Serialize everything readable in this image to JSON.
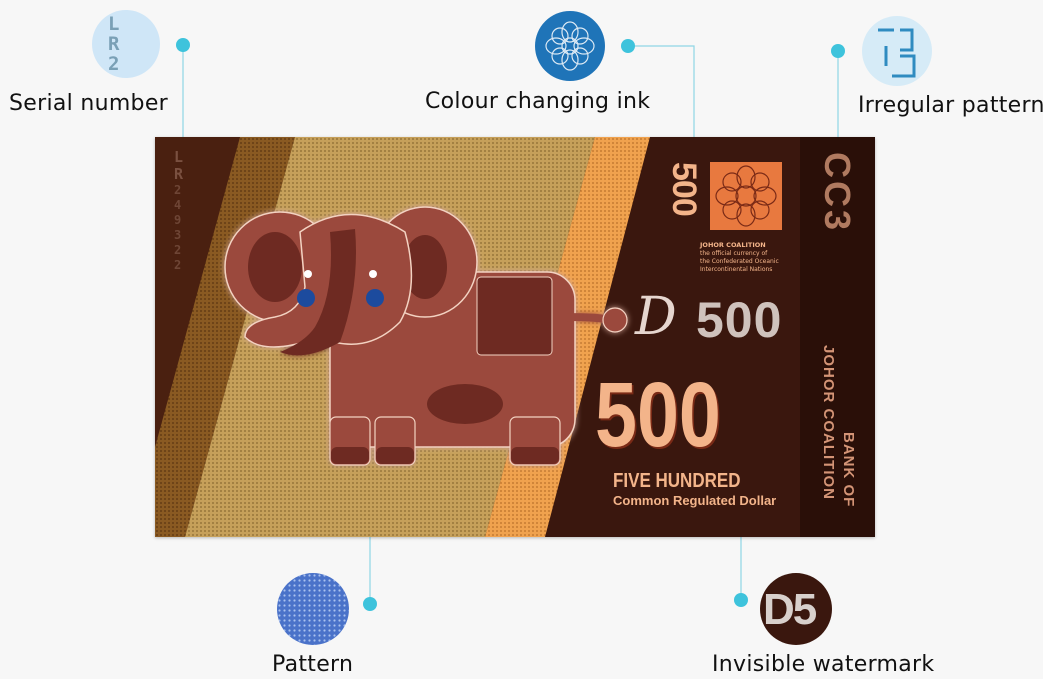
{
  "callouts": {
    "serial_number": "Serial number",
    "colour_changing_ink": "Colour changing ink",
    "irregular_pattern": "Irregular pattern",
    "pattern": "Pattern",
    "invisible_watermark": "Invisible watermark"
  },
  "banknote": {
    "serial_prefix": "LR",
    "serial_digits": "249322",
    "denomination": "500",
    "denomination_symbol": "D",
    "amount_words": "FIVE HUNDRED",
    "currency_name": "Common Regulated Dollar",
    "issuer_line1": "JOHOR COALITION",
    "issuer_line2": "the official currency of",
    "issuer_line3": "the Confederated Oceanic",
    "issuer_line4": "Intercontinental Nations",
    "bank_line1": "BANK OF",
    "bank_line2": "JOHOR COALITION",
    "watermark_text": "D5",
    "irregular_glyphs": "CC3",
    "thumb_serial": "LR2"
  },
  "colors": {
    "accent_dot": "#3ec3dc",
    "note_dark": "#3a170e",
    "note_gold": "#c9a25c",
    "note_orange": "#f2a552",
    "elephant": "#9b4a3c",
    "text_peach": "#f3b48a"
  }
}
